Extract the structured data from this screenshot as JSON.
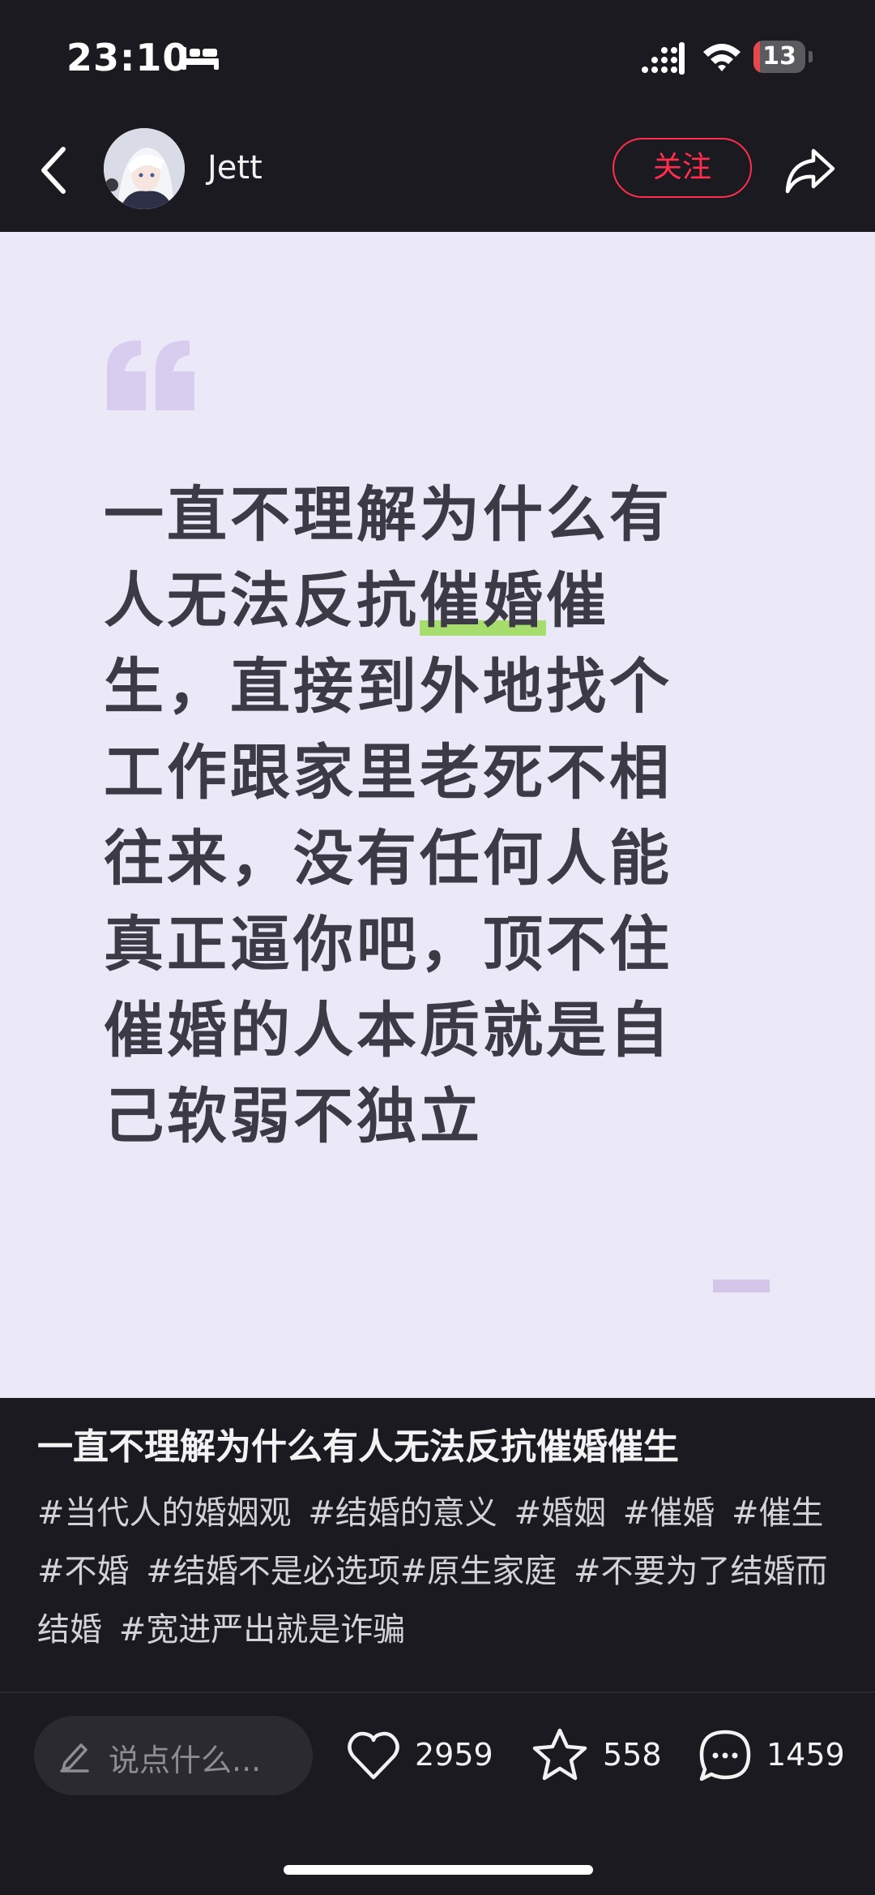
{
  "status_bar": {
    "time": "23:10",
    "battery_level": "13",
    "battery_fraction": 0.13
  },
  "header": {
    "username": "Jett",
    "follow_label": "关注"
  },
  "note": {
    "quote_lines": [
      {
        "parts": [
          {
            "text": "一直不理解为什么有",
            "highlight": false
          }
        ]
      },
      {
        "parts": [
          {
            "text": "人无法反抗",
            "highlight": false
          },
          {
            "text": "催婚",
            "highlight": true
          },
          {
            "text": "催",
            "highlight": false
          }
        ]
      },
      {
        "parts": [
          {
            "text": "生，直接到外地找个",
            "highlight": false
          }
        ]
      },
      {
        "parts": [
          {
            "text": "工作跟家里老死不相",
            "highlight": false
          }
        ]
      },
      {
        "parts": [
          {
            "text": "往来，没有任何人能",
            "highlight": false
          }
        ]
      },
      {
        "parts": [
          {
            "text": "真正逼你吧，顶不住",
            "highlight": false
          }
        ]
      },
      {
        "parts": [
          {
            "text": "催婚的人本质就是自",
            "highlight": false
          }
        ]
      },
      {
        "parts": [
          {
            "text": "己软弱不独立",
            "highlight": false
          }
        ]
      }
    ],
    "caption_title": "一直不理解为什么有人无法反抗催婚催生",
    "tags": [
      "#当代人的婚姻观",
      "#结婚的意义",
      "#婚姻",
      "#催婚",
      "#催生",
      "#不婚",
      "#结婚不是必选项#原生家庭",
      "#不要为了结婚而结婚",
      "#宽进严出就是诈骗"
    ]
  },
  "bottom_bar": {
    "comment_placeholder": "说点什么...",
    "like_count": "2959",
    "collect_count": "558",
    "comment_count": "1459"
  },
  "colors": {
    "background": "#1b1a20",
    "card": "#ebe8f7",
    "quote_text": "#3b3a45",
    "highlight": "#a7dd6d",
    "follow": "#ff2e4d"
  },
  "icons": [
    "sleep-icon",
    "signal-icon",
    "wifi-icon",
    "back-icon",
    "share-icon",
    "quote-icon",
    "pencil-icon",
    "heart-icon",
    "star-icon",
    "chat-bubble-icon"
  ]
}
